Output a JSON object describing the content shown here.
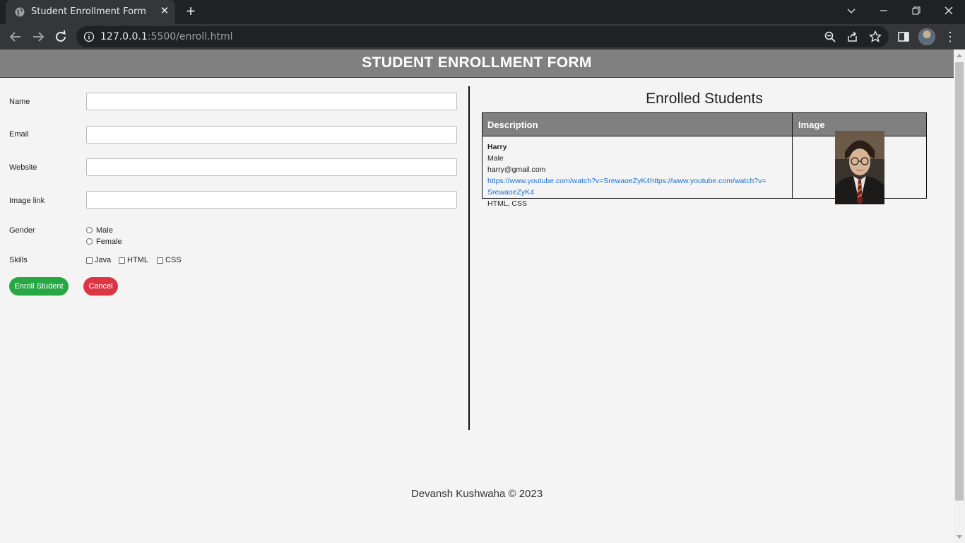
{
  "browser": {
    "tab_title": "Student Enrollment Form",
    "url_host": "127.0.0.1",
    "url_rest": ":5500/enroll.html"
  },
  "header": {
    "title": "STUDENT ENROLLMENT FORM"
  },
  "form": {
    "name_label": "Name",
    "email_label": "Email",
    "website_label": "Website",
    "image_label": "Image link",
    "gender_label": "Gender",
    "gender_options": [
      "Male",
      "Female"
    ],
    "skills_label": "Skills",
    "skills_options": [
      "Java",
      "HTML",
      "CSS"
    ],
    "enroll_button": "Enroll Student",
    "cancel_button": "Cancel",
    "colors": {
      "enroll": "#28a745",
      "cancel": "#dc3545"
    }
  },
  "enrolled": {
    "title": "Enrolled Students",
    "columns": [
      "Description",
      "Image"
    ],
    "rows": [
      {
        "name": "Harry",
        "gender": "Male",
        "email": "harry@gmail.com",
        "website": "https://www.youtube.com/watch?v=SrewaoeZyK4https://www.youtube.com/watch?v=SrewaoeZyK4",
        "skills": "HTML, CSS"
      }
    ]
  },
  "footer": {
    "text": "Devansh Kushwaha © 2023"
  }
}
